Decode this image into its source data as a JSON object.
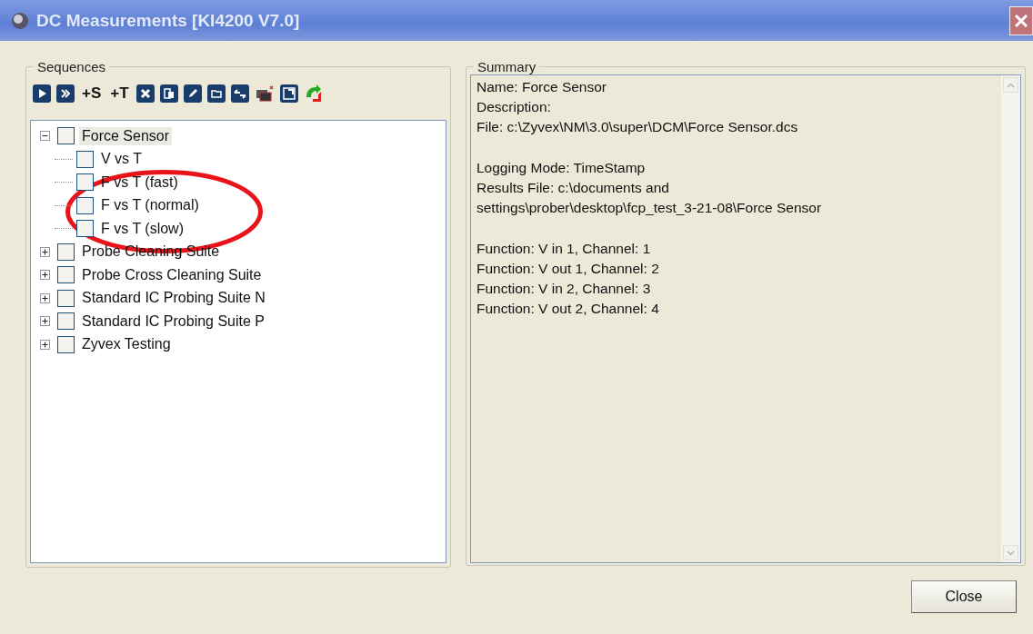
{
  "window": {
    "title": "DC Measurements [KI4200 V7.0]"
  },
  "sequences": {
    "title": "Sequences",
    "toolbar": [
      {
        "kind": "play"
      },
      {
        "kind": "fast"
      },
      {
        "kind": "text",
        "label": "+S"
      },
      {
        "kind": "text",
        "label": "+T"
      },
      {
        "kind": "delete"
      },
      {
        "kind": "copy"
      },
      {
        "kind": "edit"
      },
      {
        "kind": "folder"
      },
      {
        "kind": "swap"
      },
      {
        "kind": "windows"
      },
      {
        "kind": "maximize"
      },
      {
        "kind": "refresh"
      }
    ],
    "tree": [
      {
        "label": "Force Sensor",
        "expanded": true,
        "checked": false,
        "selected": true,
        "children": [
          {
            "label": "V vs T",
            "checked": false,
            "selected": false
          },
          {
            "label": "F vs T (fast)",
            "checked": false,
            "selected": false
          },
          {
            "label": "F vs T (normal)",
            "checked": false,
            "selected": false
          },
          {
            "label": "F vs T (slow)",
            "checked": false,
            "selected": false
          }
        ]
      },
      {
        "label": "Probe Cleaning Suite",
        "expanded": false,
        "checked": false,
        "selected": false
      },
      {
        "label": "Probe Cross Cleaning Suite",
        "expanded": false,
        "checked": false,
        "selected": false
      },
      {
        "label": "Standard IC Probing Suite N",
        "expanded": false,
        "checked": false,
        "selected": false
      },
      {
        "label": "Standard IC Probing Suite P",
        "expanded": false,
        "checked": false,
        "selected": false
      },
      {
        "label": "Zyvex Testing",
        "expanded": false,
        "checked": false,
        "selected": false
      }
    ]
  },
  "summary": {
    "title": "Summary",
    "paragraphs": [
      [
        "Name: Force Sensor",
        "Description:",
        "File: c:\\Zyvex\\NM\\3.0\\super\\DCM\\Force Sensor.dcs"
      ],
      [
        "Logging Mode: TimeStamp",
        "Results File: c:\\documents and",
        "settings\\prober\\desktop\\fcp_test_3-21-08\\Force Sensor"
      ],
      [
        "Function: V in 1, Channel: 1",
        "Function: V out 1, Channel: 2",
        "Function: V in 2, Channel: 3",
        "Function: V out 2, Channel: 4"
      ]
    ]
  },
  "buttons": [
    "Close"
  ]
}
